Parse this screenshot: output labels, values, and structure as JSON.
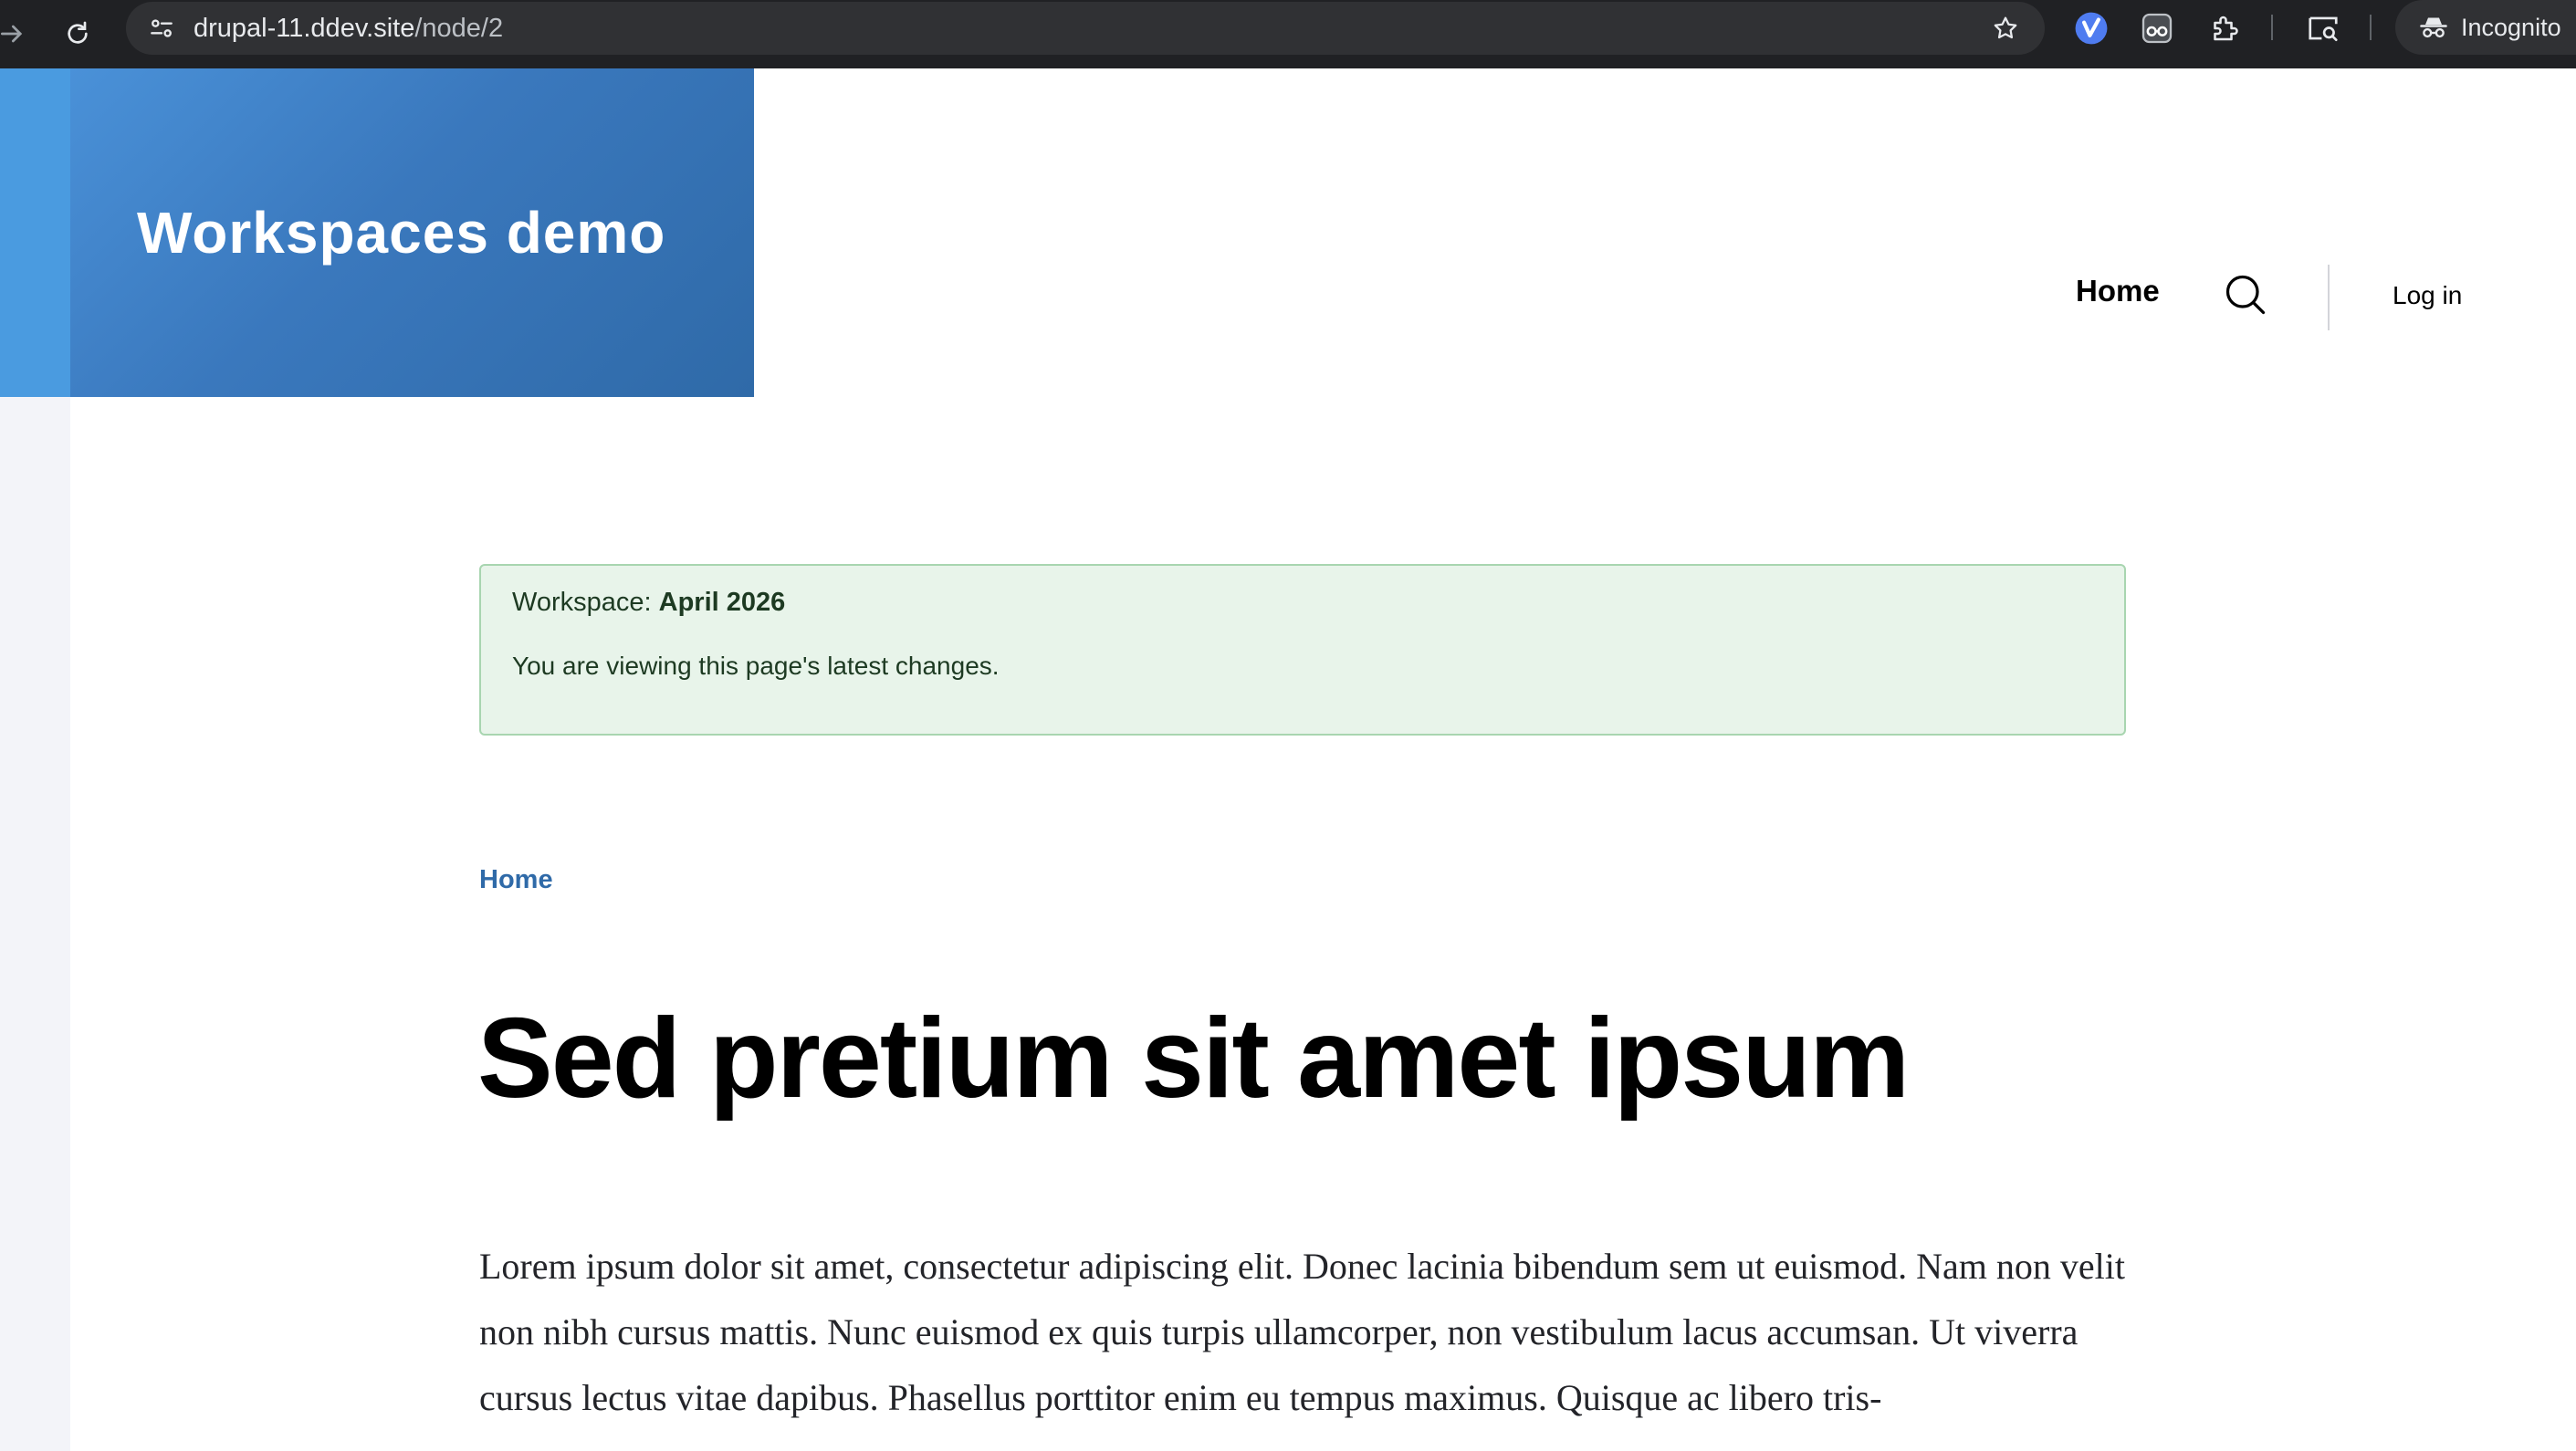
{
  "browser": {
    "url_host": "drupal-11.ddev.site",
    "url_path": "/node/2",
    "incognito_label": "Incognito",
    "icons": [
      "forward-arrow-icon",
      "reload-icon",
      "site-info-icon",
      "bookmark-star-icon",
      "extension-v-icon",
      "extension-glasses-icon",
      "extensions-puzzle-icon",
      "tab-search-icon",
      "incognito-icon"
    ]
  },
  "site": {
    "name": "Workspaces demo",
    "colors": {
      "brand_blue": "#3a78bd",
      "message_bg": "#e8f4ea",
      "message_border": "#a8d5b0",
      "link": "#2f6aa8"
    }
  },
  "nav": {
    "home": "Home",
    "login": "Log in"
  },
  "workspace_message": {
    "label": "Workspace: ",
    "name": "April 2026",
    "detail": "You are viewing this page's latest changes."
  },
  "breadcrumb": {
    "home": "Home"
  },
  "node": {
    "title": "Sed pretium sit amet ipsum",
    "body": "Lorem ipsum dolor sit amet, consectetur adipiscing elit. Donec lacinia bibendum sem ut euismod. Nam non velit non nibh cursus mattis. Nunc euismod ex quis turpis ullamcorper, non vestibulum lacus accumsan. Ut viverra cursus lectus vitae dapibus. Phasellus porttitor enim eu tempus maximus. Quisque ac libero tris-"
  }
}
